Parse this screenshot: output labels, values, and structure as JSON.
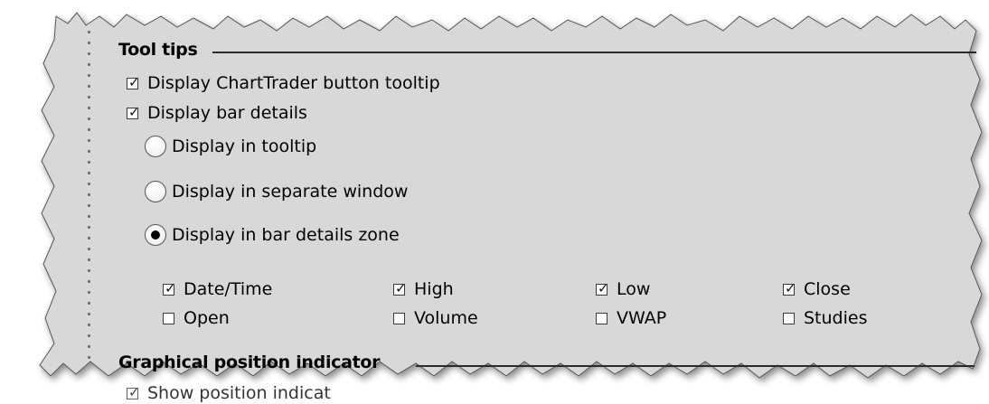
{
  "colors": {
    "panel_bg": "#d8d8d8",
    "border": "#444444",
    "rule": "#2a2a2a"
  },
  "tooltips_section": {
    "title": "Tool tips",
    "chart_trader_tooltip": {
      "label": "Display ChartTrader button tooltip",
      "checked": true
    },
    "bar_details": {
      "label": "Display bar details",
      "checked": true
    },
    "radio_options": [
      {
        "label": "Display in tooltip",
        "selected": false
      },
      {
        "label": "Display in separate window",
        "selected": false
      },
      {
        "label": "Display in bar details zone",
        "selected": true
      }
    ],
    "fields": [
      {
        "label": "Date/Time",
        "checked": true
      },
      {
        "label": "High",
        "checked": true
      },
      {
        "label": "Low",
        "checked": true
      },
      {
        "label": "Close",
        "checked": true
      },
      {
        "label": "Open",
        "checked": false
      },
      {
        "label": "Volume",
        "checked": false
      },
      {
        "label": "VWAP",
        "checked": false
      },
      {
        "label": "Studies",
        "checked": false
      }
    ]
  },
  "position_section": {
    "title": "Graphical position indicator",
    "show_position": {
      "label": "Show position indicat",
      "checked": true
    }
  }
}
